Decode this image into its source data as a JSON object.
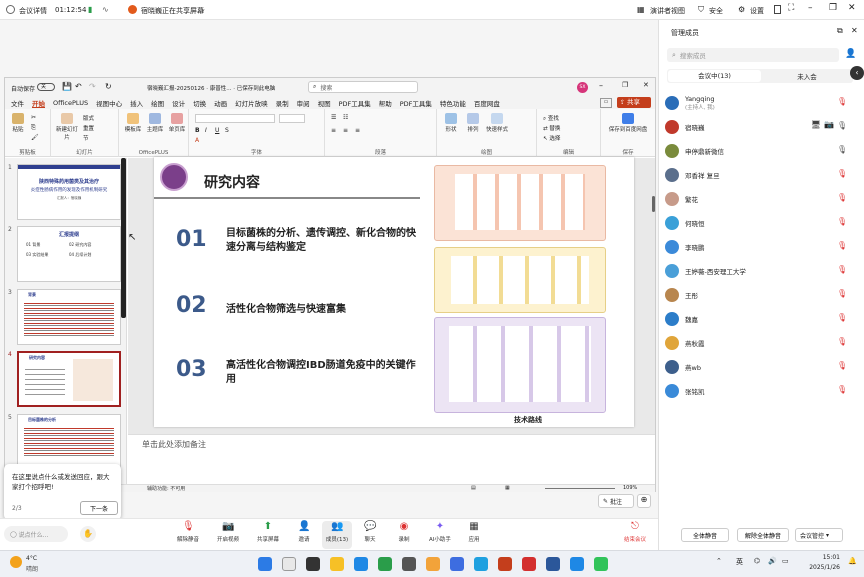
{
  "meeting_bar": {
    "details": "会议详情",
    "timer": "01:12:54",
    "sharer": "宿晓巍正在共享屏幕",
    "speaker_view": "演讲者视图",
    "security": "安全",
    "settings": "设置"
  },
  "ppt": {
    "autosave": "自动保存",
    "autosave_state": "关",
    "file_title": "宿晓巍汇报-20250126 · 康普性... · 已保存到此电脑",
    "search_placeholder": "搜索",
    "user_initials": "SX",
    "share_button": "共享",
    "menu": [
      "文件",
      "开始",
      "OfficePLUS",
      "视图中心",
      "插入",
      "绘图",
      "设计",
      "切换",
      "动画",
      "幻灯片放映",
      "录制",
      "审阅",
      "视图",
      "PDF工具集",
      "帮助",
      "PDF工具集",
      "特色功能",
      "百度网盘"
    ],
    "ribbon": {
      "paste": "粘贴",
      "clipboard": "剪贴板",
      "new_slide": "新建幻灯片",
      "format": "版式",
      "reset": "重置",
      "section": "节",
      "slides": "幻灯片",
      "template": "模板库",
      "theme": "主题库",
      "single_page": "单页库",
      "officeplus": "OfficePLUS",
      "font": "字体",
      "paragraph": "段落",
      "shapes": "形状",
      "arrange": "排列",
      "quick_styles": "快速样式",
      "drawing": "绘图",
      "find": "查找",
      "replace": "替换",
      "select": "选择",
      "editing": "编辑",
      "save_baidu": "保存到百度网盘",
      "save": "保存"
    },
    "thumbnails": [
      {
        "num": "1",
        "title": "陕西特殊药用菌类及其治疗",
        "sub": "炎症性肠病作用的发现及作用机制研究",
        "presenter": "汇报人：宿晓巍"
      },
      {
        "num": "2",
        "title": "汇报提纲",
        "items": [
          "01 背景",
          "02 研究内容",
          "03 实验结果",
          "04 后续计划"
        ]
      },
      {
        "num": "3",
        "title": "背景"
      },
      {
        "num": "4",
        "title": "研究内容"
      },
      {
        "num": "5",
        "title": "目标菌株的分析"
      }
    ],
    "slide": {
      "title": "研究内容",
      "items": [
        {
          "num": "01",
          "text": "目标菌株的分析、遗传调控、新化合物的快速分离与结构鉴定"
        },
        {
          "num": "02",
          "text": "活性化合物筛选与快速富集"
        },
        {
          "num": "03",
          "text": "高活性化合物调控IBD肠道免疫中的关键作用"
        }
      ],
      "diagram_caption": "技术路线"
    },
    "notes_placeholder": "单击此处添加备注",
    "status": {
      "accessibility": "辅助功能: 不可用",
      "zoom": "109%",
      "comments": "批注"
    }
  },
  "toolbar": {
    "items": [
      "解除静音",
      "开启视频",
      "共享屏幕",
      "邀请",
      "成员(13)",
      "聊天",
      "录制",
      "AI小助手",
      "应用"
    ],
    "leave": "结束会议",
    "chat_placeholder": "说点什么..."
  },
  "tip": {
    "text": "在这里说点什么或发送回应，跟大家打个招呼吧!",
    "page": "2/3",
    "next": "下一条"
  },
  "panel": {
    "title": "管理成员",
    "search_placeholder": "搜索成员",
    "tab_in": "会议中(13)",
    "tab_out": "未入会",
    "members": [
      {
        "name": "Yangqing",
        "sub": "(主持人, 我)",
        "color": "#2a6db8"
      },
      {
        "name": "宿晓巍",
        "sub": "",
        "color": "#c0392b"
      },
      {
        "name": "申停鼎新微信",
        "sub": "",
        "color": "#7a8b3c"
      },
      {
        "name": "邓香祥 复旦",
        "sub": "",
        "color": "#5b6f8c"
      },
      {
        "name": "繁花",
        "sub": "",
        "color": "#c79b8a"
      },
      {
        "name": "何晓恒",
        "sub": "",
        "color": "#3aa0d8"
      },
      {
        "name": "李晓鹏",
        "sub": "",
        "color": "#3b8ad9"
      },
      {
        "name": "王婷薇-西安理工大学",
        "sub": "",
        "color": "#4a9fd8"
      },
      {
        "name": "王彤",
        "sub": "",
        "color": "#b8864e"
      },
      {
        "name": "魏嘉",
        "sub": "",
        "color": "#2c7dc9"
      },
      {
        "name": "燕秋霞",
        "sub": "",
        "color": "#e0a53a"
      },
      {
        "name": "燕wb",
        "sub": "",
        "color": "#3d5f8c"
      },
      {
        "name": "张铭凯",
        "sub": "",
        "color": "#3a8ad8"
      }
    ],
    "mute_all": "全体静音",
    "unmute_all": "解除全体静音",
    "controls": "会议管控"
  },
  "taskbar": {
    "weather_temp": "4°C",
    "weather_desc": "晴朗",
    "lang": "英",
    "time": "15:01",
    "date": "2025/1/26"
  }
}
